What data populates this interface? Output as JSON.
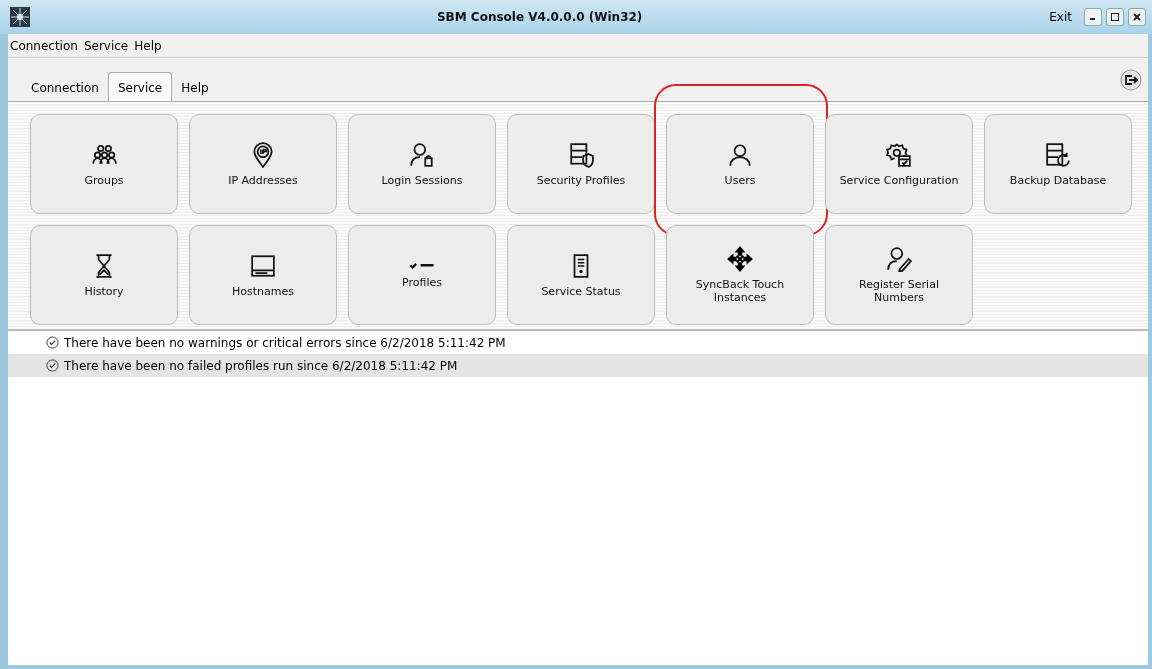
{
  "window": {
    "title": "SBM Console V4.0.0.0 (Win32)",
    "exit": "Exit"
  },
  "menu": [
    "Connection",
    "Service",
    "Help"
  ],
  "tabs": [
    {
      "label": "Connection",
      "selected": false
    },
    {
      "label": "Service",
      "selected": true
    },
    {
      "label": "Help",
      "selected": false
    }
  ],
  "tiles": [
    {
      "label": "Groups",
      "highlighted": false
    },
    {
      "label": "IP Addresses",
      "highlighted": false
    },
    {
      "label": "Login Sessions",
      "highlighted": false
    },
    {
      "label": "Security Profiles",
      "highlighted": false
    },
    {
      "label": "Users",
      "highlighted": true
    },
    {
      "label": "Service Configuration",
      "highlighted": false
    },
    {
      "label": "Backup Database",
      "highlighted": false
    },
    {
      "label": "History",
      "highlighted": false
    },
    {
      "label": "Hostnames",
      "highlighted": false
    },
    {
      "label": "Profiles",
      "highlighted": false
    },
    {
      "label": "Service Status",
      "highlighted": false
    },
    {
      "label": "SyncBack Touch Instances",
      "highlighted": false
    },
    {
      "label": "Register Serial Numbers",
      "highlighted": false
    }
  ],
  "messages": [
    {
      "text": "There have been no warnings or critical errors since 6/2/2018 5:11:42 PM",
      "selected": false
    },
    {
      "text": "There have been no failed profiles run since 6/2/2018 5:11:42 PM",
      "selected": true
    }
  ]
}
